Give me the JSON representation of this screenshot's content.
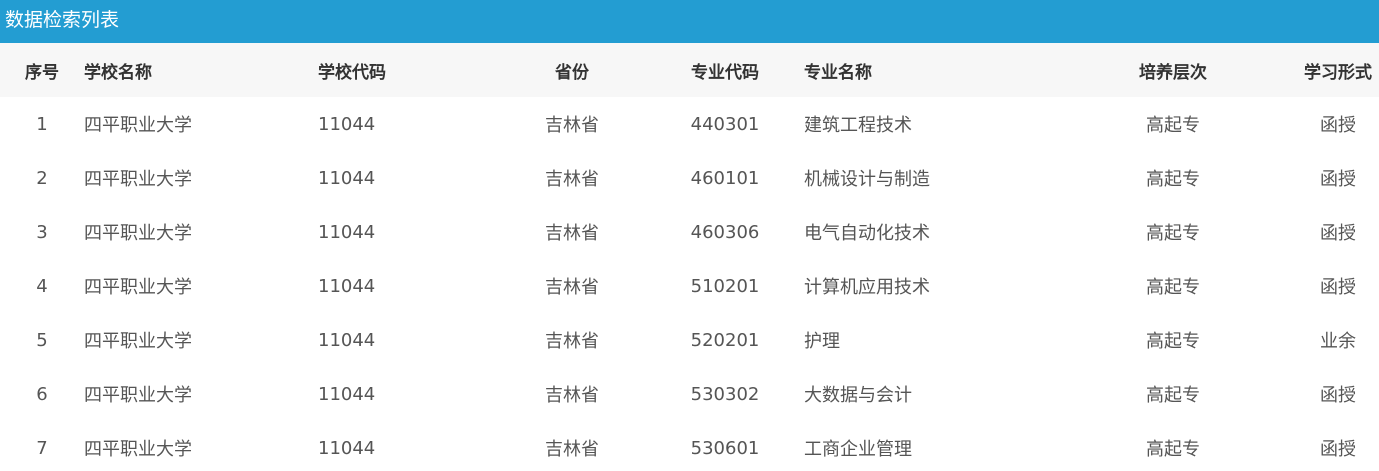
{
  "panel": {
    "title": "数据检索列表"
  },
  "table": {
    "columns": [
      "序号",
      "学校名称",
      "学校代码",
      "省份",
      "专业代码",
      "专业名称",
      "培养层次",
      "学习形式"
    ],
    "rows": [
      [
        "1",
        "四平职业大学",
        "11044",
        "吉林省",
        "440301",
        "建筑工程技术",
        "高起专",
        "函授"
      ],
      [
        "2",
        "四平职业大学",
        "11044",
        "吉林省",
        "460101",
        "机械设计与制造",
        "高起专",
        "函授"
      ],
      [
        "3",
        "四平职业大学",
        "11044",
        "吉林省",
        "460306",
        "电气自动化技术",
        "高起专",
        "函授"
      ],
      [
        "4",
        "四平职业大学",
        "11044",
        "吉林省",
        "510201",
        "计算机应用技术",
        "高起专",
        "函授"
      ],
      [
        "5",
        "四平职业大学",
        "11044",
        "吉林省",
        "520201",
        "护理",
        "高起专",
        "业余"
      ],
      [
        "6",
        "四平职业大学",
        "11044",
        "吉林省",
        "530302",
        "大数据与会计",
        "高起专",
        "函授"
      ],
      [
        "7",
        "四平职业大学",
        "11044",
        "吉林省",
        "530601",
        "工商企业管理",
        "高起专",
        "函授"
      ]
    ]
  },
  "colors": {
    "title_bar": "#239dd2",
    "header_bg": "#f7f7f7"
  }
}
